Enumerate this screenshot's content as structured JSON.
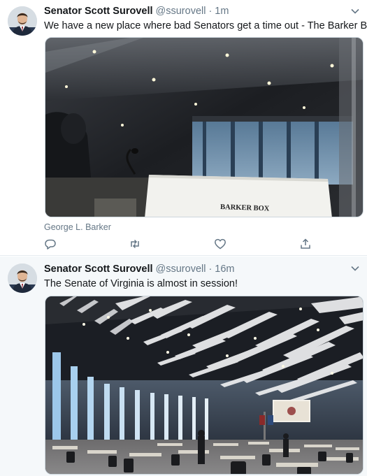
{
  "tweets": [
    {
      "author_name": "Senator Scott Surovell",
      "handle": "@ssurovell",
      "separator": "·",
      "time": "1m",
      "text": "We have a new place where bad Senators get a time out - The Barker Box!",
      "media_sign_text": "BARKER BOX",
      "photo_credit": "George L. Barker"
    },
    {
      "author_name": "Senator Scott Surovell",
      "handle": "@ssurovell",
      "separator": "·",
      "time": "16m",
      "text": "The Senate of Virginia is almost in session!"
    }
  ],
  "icons": {
    "reply": "reply-icon",
    "retweet": "retweet-icon",
    "like": "heart-icon",
    "share": "share-icon",
    "menu": "chevron-down-icon"
  },
  "colors": {
    "name": "#14171a",
    "secondary_text": "#657786",
    "highlight_background": "#f5f8fa"
  }
}
